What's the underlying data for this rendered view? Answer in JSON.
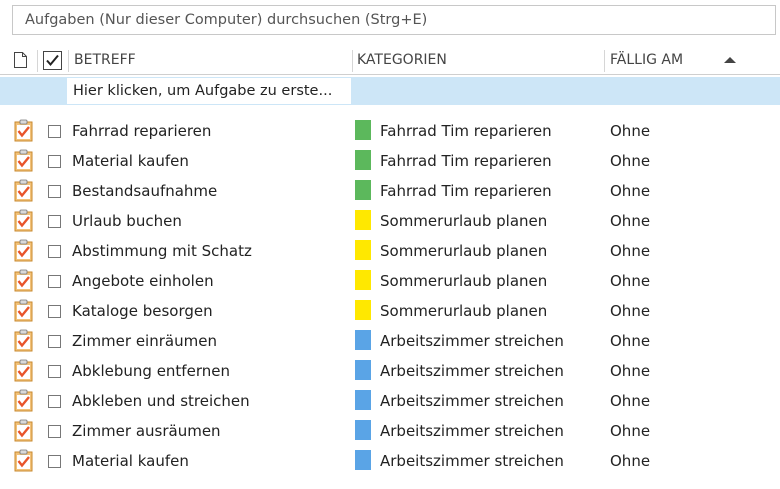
{
  "search": {
    "placeholder": "Aufgaben (Nur dieser Computer) durchsuchen (Strg+E)"
  },
  "header": {
    "col_subject": "BETREFF",
    "col_categories": "KATEGORIEN",
    "col_due": "FÄLLIG AM"
  },
  "new_task": {
    "label": "Hier klicken, um Aufgabe zu erste..."
  },
  "colors": {
    "green": "#5cb85c",
    "yellow": "#ffe800",
    "blue": "#5aa4e6",
    "new_row_bg": "#cde6f7"
  },
  "tasks": [
    {
      "subject": "Fahrrad reparieren",
      "category": "Fahrrad Tim reparieren",
      "color": "#5cb85c",
      "due": "Ohne"
    },
    {
      "subject": "Material kaufen",
      "category": "Fahrrad Tim reparieren",
      "color": "#5cb85c",
      "due": "Ohne"
    },
    {
      "subject": "Bestandsaufnahme",
      "category": "Fahrrad Tim reparieren",
      "color": "#5cb85c",
      "due": "Ohne"
    },
    {
      "subject": "Urlaub buchen",
      "category": "Sommerurlaub planen",
      "color": "#ffe800",
      "due": "Ohne"
    },
    {
      "subject": "Abstimmung mit Schatz",
      "category": "Sommerurlaub planen",
      "color": "#ffe800",
      "due": "Ohne"
    },
    {
      "subject": "Angebote einholen",
      "category": "Sommerurlaub planen",
      "color": "#ffe800",
      "due": "Ohne"
    },
    {
      "subject": "Kataloge besorgen",
      "category": "Sommerurlaub planen",
      "color": "#ffe800",
      "due": "Ohne"
    },
    {
      "subject": "Zimmer einräumen",
      "category": "Arbeitszimmer streichen",
      "color": "#5aa4e6",
      "due": "Ohne"
    },
    {
      "subject": "Abklebung entfernen",
      "category": "Arbeitszimmer streichen",
      "color": "#5aa4e6",
      "due": "Ohne"
    },
    {
      "subject": "Abkleben und streichen",
      "category": "Arbeitszimmer streichen",
      "color": "#5aa4e6",
      "due": "Ohne"
    },
    {
      "subject": "Zimmer ausräumen",
      "category": "Arbeitszimmer streichen",
      "color": "#5aa4e6",
      "due": "Ohne"
    },
    {
      "subject": "Material kaufen",
      "category": "Arbeitszimmer streichen",
      "color": "#5aa4e6",
      "due": "Ohne"
    }
  ]
}
